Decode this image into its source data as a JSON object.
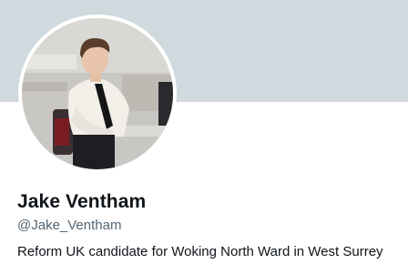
{
  "profile": {
    "display_name": "Jake Ventham",
    "handle": "@Jake_Ventham",
    "bio": "Reform UK candidate for Woking North Ward in West Surrey"
  },
  "colors": {
    "banner": "#cfd9de",
    "name_text": "#0f1419",
    "handle_text": "#536471"
  }
}
